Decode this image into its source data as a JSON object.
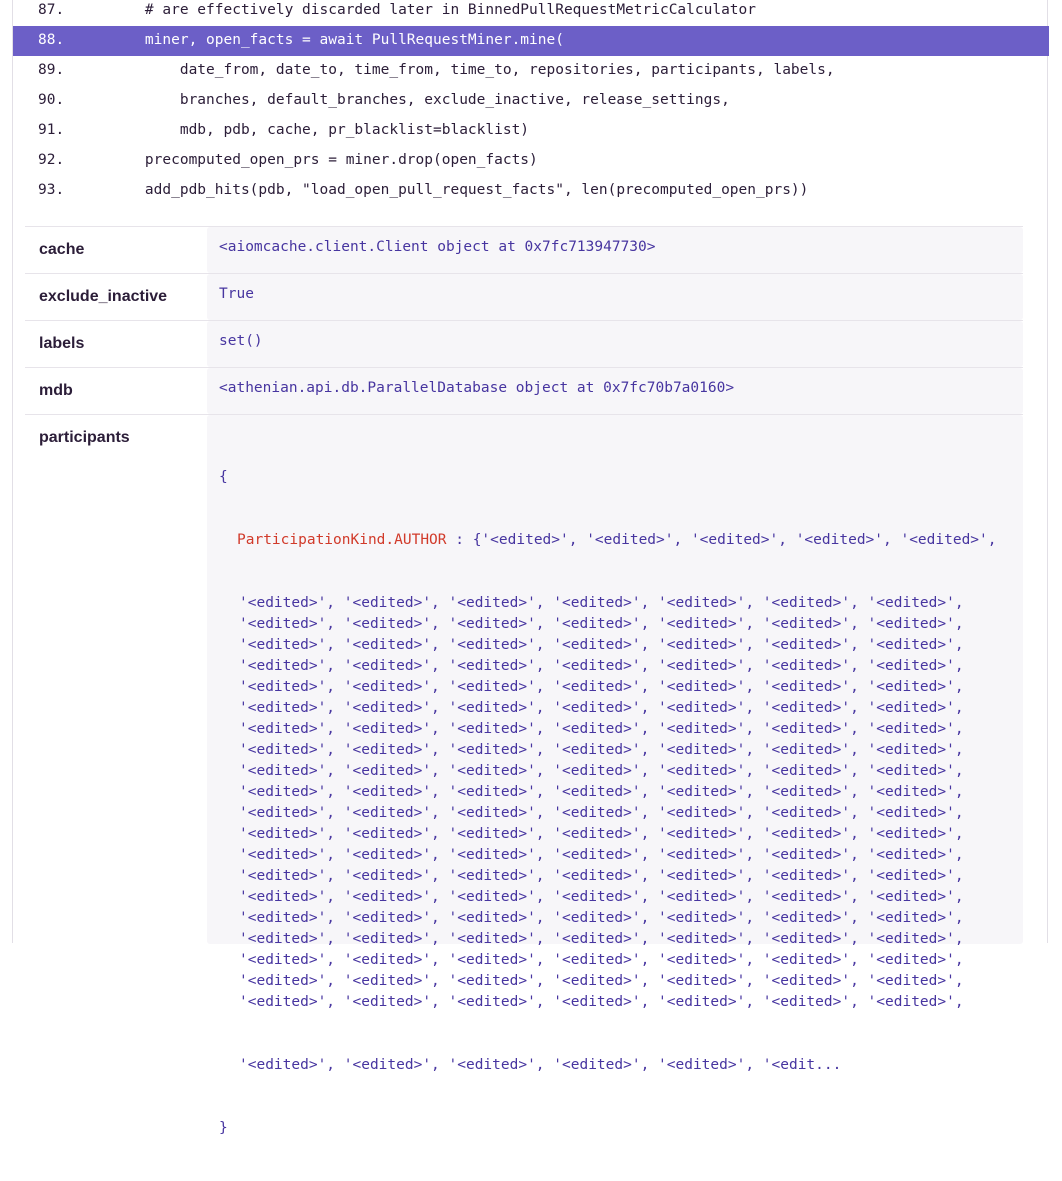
{
  "code_lines": [
    {
      "num": "87.",
      "text": "    # are effectively discarded later in BinnedPullRequestMetricCalculator"
    },
    {
      "num": "88.",
      "text": "    miner, open_facts = await PullRequestMiner.mine("
    },
    {
      "num": "89.",
      "text": "        date_from, date_to, time_from, time_to, repositories, participants, labels,"
    },
    {
      "num": "90.",
      "text": "        branches, default_branches, exclude_inactive, release_settings,"
    },
    {
      "num": "91.",
      "text": "        mdb, pdb, cache, pr_blacklist=blacklist)"
    },
    {
      "num": "92.",
      "text": "    precomputed_open_prs = miner.drop(open_facts)"
    },
    {
      "num": "93.",
      "text": "    add_pdb_hits(pdb, \"load_open_pull_request_facts\", len(precomputed_open_prs))"
    }
  ],
  "variables": {
    "cache": {
      "key": "cache",
      "value": "<aiomcache.client.Client object at 0x7fc713947730>"
    },
    "exclude_inactive": {
      "key": "exclude_inactive",
      "value": "True"
    },
    "labels": {
      "key": "labels",
      "value": "set()"
    },
    "mdb": {
      "key": "mdb",
      "value": "<athenian.api.db.ParallelDatabase object at 0x7fc70b7a0160>"
    },
    "participants": {
      "key": "participants",
      "open": "{",
      "close": "}",
      "kind": "ParticipationKind.AUTHOR",
      "first_line": " : {'<edited>', '<edited>', '<edited>', '<edited>', '<edited>',",
      "repeat_line": "'<edited>', '<edited>', '<edited>', '<edited>', '<edited>', '<edited>', '<edited>',",
      "last_line": "'<edited>', '<edited>', '<edited>', '<edited>', '<edited>', '<edit..."
    }
  },
  "colors": {
    "active_line_bg": "#6c5fc7",
    "value_text": "#4735a0",
    "kind_text": "#d13a2a"
  }
}
